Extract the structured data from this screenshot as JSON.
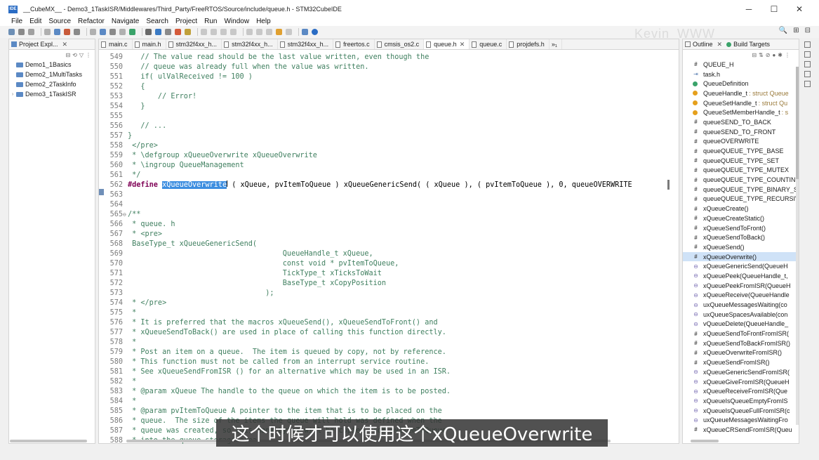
{
  "window": {
    "app_icon_label": "IDE",
    "title": "__CubeMX__ - Demo3_1TaskISR/Middlewares/Third_Party/FreeRTOS/Source/include/queue.h - STM32CubeIDE",
    "controls": [
      "─",
      "☐",
      "✕"
    ]
  },
  "menu": [
    "File",
    "Edit",
    "Source",
    "Refactor",
    "Navigate",
    "Search",
    "Project",
    "Run",
    "Window",
    "Help"
  ],
  "watermark": "Kevin_WWW",
  "toolbar_right": [
    "🔍",
    "⊞",
    "⊟"
  ],
  "project_explorer": {
    "tab_label": "Project Expl...",
    "close": "✕",
    "tools": [
      "⊟",
      "⟲",
      "▽",
      "⋮"
    ],
    "projects": [
      {
        "name": "Demo1_1Basics",
        "arrow": ""
      },
      {
        "name": "Demo2_1MultiTasks",
        "arrow": ""
      },
      {
        "name": "Demo2_2TaskInfo",
        "arrow": ""
      },
      {
        "name": "Demo3_1TaskISR",
        "arrow": "›"
      }
    ]
  },
  "editor": {
    "tabs": [
      {
        "label": "main.c",
        "close": ""
      },
      {
        "label": "main.h",
        "close": ""
      },
      {
        "label": "stm32f4xx_h...",
        "close": ""
      },
      {
        "label": "stm32f4xx_h...",
        "close": ""
      },
      {
        "label": "stm32f4xx_h...",
        "close": ""
      },
      {
        "label": "freertos.c",
        "close": ""
      },
      {
        "label": "cmsis_os2.c",
        "close": ""
      },
      {
        "label": "queue.h",
        "close": "✕"
      },
      {
        "label": "queue.c",
        "close": ""
      },
      {
        "label": "projdefs.h",
        "close": ""
      },
      {
        "label": "»₁",
        "close": ""
      }
    ],
    "lines": [
      {
        "n": "549",
        "fold": "",
        "t": "   // The value read should be the last value written, even though the"
      },
      {
        "n": "550",
        "fold": "",
        "t": "   // queue was already full when the value was written."
      },
      {
        "n": "551",
        "fold": "",
        "t": "   if( ulValReceived != 100 )"
      },
      {
        "n": "552",
        "fold": "",
        "t": "   {"
      },
      {
        "n": "553",
        "fold": "",
        "t": "       // Error!"
      },
      {
        "n": "554",
        "fold": "",
        "t": "   }"
      },
      {
        "n": "555",
        "fold": "",
        "t": ""
      },
      {
        "n": "556",
        "fold": "",
        "t": "   // ..."
      },
      {
        "n": "557",
        "fold": "",
        "t": "}"
      },
      {
        "n": "558",
        "fold": "",
        "t": " </pre>"
      },
      {
        "n": "559",
        "fold": "",
        "t": " * \\defgroup xQueueOverwrite xQueueOverwrite"
      },
      {
        "n": "560",
        "fold": "",
        "t": " * \\ingroup QueueManagement"
      },
      {
        "n": "561",
        "fold": "",
        "t": " */"
      },
      {
        "n": "562",
        "fold": "",
        "t": ""
      },
      {
        "n": "563",
        "fold": "",
        "t": ""
      },
      {
        "n": "564",
        "fold": "",
        "t": ""
      },
      {
        "n": "565",
        "fold": "⊖",
        "t": "/**"
      },
      {
        "n": "566",
        "fold": "",
        "t": " * queue. h"
      },
      {
        "n": "567",
        "fold": "",
        "t": " * <pre>"
      },
      {
        "n": "568",
        "fold": "",
        "t": " BaseType_t xQueueGenericSend("
      },
      {
        "n": "569",
        "fold": "",
        "t": "                                    QueueHandle_t xQueue,"
      },
      {
        "n": "570",
        "fold": "",
        "t": "                                    const void * pvItemToQueue,"
      },
      {
        "n": "571",
        "fold": "",
        "t": "                                    TickType_t xTicksToWait"
      },
      {
        "n": "572",
        "fold": "",
        "t": "                                    BaseType_t xCopyPosition"
      },
      {
        "n": "573",
        "fold": "",
        "t": "                                );"
      },
      {
        "n": "574",
        "fold": "",
        "t": " * </pre>"
      },
      {
        "n": "575",
        "fold": "",
        "t": " *"
      },
      {
        "n": "576",
        "fold": "",
        "t": " * It is preferred that the macros xQueueSend(), xQueueSendToFront() and"
      },
      {
        "n": "577",
        "fold": "",
        "t": " * xQueueSendToBack() are used in place of calling this function directly."
      },
      {
        "n": "578",
        "fold": "",
        "t": " *"
      },
      {
        "n": "579",
        "fold": "",
        "t": " * Post an item on a queue.  The item is queued by copy, not by reference."
      },
      {
        "n": "580",
        "fold": "",
        "t": " * This function must not be called from an interrupt service routine."
      },
      {
        "n": "581",
        "fold": "",
        "t": " * See xQueueSendFromISR () for an alternative which may be used in an ISR."
      },
      {
        "n": "582",
        "fold": "",
        "t": " *"
      },
      {
        "n": "583",
        "fold": "",
        "t": " * @param xQueue The handle to the queue on which the item is to be posted."
      },
      {
        "n": "584",
        "fold": "",
        "t": " *"
      },
      {
        "n": "585",
        "fold": "",
        "t": " * @param pvItemToQueue A pointer to the item that is to be placed on the"
      },
      {
        "n": "586",
        "fold": "",
        "t": " * queue.  The size of the items the queue will hold was defined when the"
      },
      {
        "n": "587",
        "fold": "",
        "t": " * queue was created, so this many bytes will be copied from pvItemToQueue"
      },
      {
        "n": "588",
        "fold": "",
        "t": " * into the queue storage area."
      }
    ],
    "define_line": {
      "keyword": "#define",
      "selected": "xQueueOverwrite",
      "rest": "( xQueue, pvItemToQueue ) xQueueGenericSend( ( xQueue ), ( pvItemToQueue ), 0, queueOVERWRITE"
    }
  },
  "outline": {
    "tabs": [
      {
        "label": "Outline",
        "close": "✕"
      },
      {
        "label": "Build Targets",
        "close": ""
      }
    ],
    "tools": [
      "⊟",
      "⇅",
      "⊘",
      "●",
      "✱",
      "⋮"
    ],
    "items": [
      {
        "icon": "#",
        "icon_kind": "define",
        "label": "QUEUE_H",
        "type": ""
      },
      {
        "icon": "⇥",
        "icon_kind": "include",
        "label": "task.h",
        "type": ""
      },
      {
        "icon": "",
        "icon_kind": "struct",
        "label": "QueueDefinition",
        "type": ""
      },
      {
        "icon": "",
        "icon_kind": "typedef",
        "label": "QueueHandle_t",
        "type": ": struct Queue"
      },
      {
        "icon": "",
        "icon_kind": "typedef",
        "label": "QueueSetHandle_t",
        "type": ": struct Qu"
      },
      {
        "icon": "",
        "icon_kind": "typedef",
        "label": "QueueSetMemberHandle_t",
        "type": ": s"
      },
      {
        "icon": "#",
        "icon_kind": "define",
        "label": "queueSEND_TO_BACK",
        "type": ""
      },
      {
        "icon": "#",
        "icon_kind": "define",
        "label": "queueSEND_TO_FRONT",
        "type": ""
      },
      {
        "icon": "#",
        "icon_kind": "define",
        "label": "queueOVERWRITE",
        "type": ""
      },
      {
        "icon": "#",
        "icon_kind": "define",
        "label": "queueQUEUE_TYPE_BASE",
        "type": ""
      },
      {
        "icon": "#",
        "icon_kind": "define",
        "label": "queueQUEUE_TYPE_SET",
        "type": ""
      },
      {
        "icon": "#",
        "icon_kind": "define",
        "label": "queueQUEUE_TYPE_MUTEX",
        "type": ""
      },
      {
        "icon": "#",
        "icon_kind": "define",
        "label": "queueQUEUE_TYPE_COUNTIN",
        "type": ""
      },
      {
        "icon": "#",
        "icon_kind": "define",
        "label": "queueQUEUE_TYPE_BINARY_S",
        "type": ""
      },
      {
        "icon": "#",
        "icon_kind": "define",
        "label": "queueQUEUE_TYPE_RECURSIV",
        "type": ""
      },
      {
        "icon": "#",
        "icon_kind": "define",
        "label": "xQueueCreate()",
        "type": ""
      },
      {
        "icon": "#",
        "icon_kind": "define",
        "label": "xQueueCreateStatic()",
        "type": ""
      },
      {
        "icon": "#",
        "icon_kind": "define",
        "label": "xQueueSendToFront()",
        "type": ""
      },
      {
        "icon": "#",
        "icon_kind": "define",
        "label": "xQueueSendToBack()",
        "type": ""
      },
      {
        "icon": "#",
        "icon_kind": "define",
        "label": "xQueueSend()",
        "type": ""
      },
      {
        "icon": "#",
        "icon_kind": "define",
        "label": "xQueueOverwrite()",
        "type": ""
      },
      {
        "icon": "⊖",
        "icon_kind": "func",
        "label": "xQueueGenericSend(QueueH",
        "type": ""
      },
      {
        "icon": "⊖",
        "icon_kind": "func",
        "label": "xQueuePeek(QueueHandle_t,",
        "type": ""
      },
      {
        "icon": "⊖",
        "icon_kind": "func",
        "label": "xQueuePeekFromISR(QueueH",
        "type": ""
      },
      {
        "icon": "⊖",
        "icon_kind": "func",
        "label": "xQueueReceive(QueueHandle",
        "type": ""
      },
      {
        "icon": "⊖",
        "icon_kind": "func",
        "label": "uxQueueMessagesWaiting(co",
        "type": ""
      },
      {
        "icon": "⊖",
        "icon_kind": "func",
        "label": "uxQueueSpacesAvailable(con",
        "type": ""
      },
      {
        "icon": "⊖",
        "icon_kind": "func",
        "label": "vQueueDelete(QueueHandle_",
        "type": ""
      },
      {
        "icon": "#",
        "icon_kind": "define",
        "label": "xQueueSendToFrontFromISR(",
        "type": ""
      },
      {
        "icon": "#",
        "icon_kind": "define",
        "label": "xQueueSendToBackFromISR()",
        "type": ""
      },
      {
        "icon": "#",
        "icon_kind": "define",
        "label": "xQueueOverwriteFromISR()",
        "type": ""
      },
      {
        "icon": "#",
        "icon_kind": "define",
        "label": "xQueueSendFromISR()",
        "type": ""
      },
      {
        "icon": "⊖",
        "icon_kind": "func",
        "label": "xQueueGenericSendFromISR(",
        "type": ""
      },
      {
        "icon": "⊖",
        "icon_kind": "func",
        "label": "xQueueGiveFromISR(QueueH",
        "type": ""
      },
      {
        "icon": "⊖",
        "icon_kind": "func",
        "label": "xQueueReceiveFromISR(Que",
        "type": ""
      },
      {
        "icon": "⊖",
        "icon_kind": "func",
        "label": "xQueueIsQueueEmptyFromIS",
        "type": ""
      },
      {
        "icon": "⊖",
        "icon_kind": "func",
        "label": "xQueueIsQueueFullFromISR(c",
        "type": ""
      },
      {
        "icon": "⊖",
        "icon_kind": "func",
        "label": "uxQueueMessagesWaitingFro",
        "type": ""
      },
      {
        "icon": "#",
        "icon_kind": "define",
        "label": "xQueueCRSendFromISR(Queu",
        "type": ""
      }
    ]
  },
  "subtitle": "这个时候才可以使用这个xQueueOverwrite",
  "colors": {
    "selection": "#3d8ee0",
    "comment": "#3f7f5f",
    "keyword": "#7f0055",
    "outline_selected": "#cfe2f7"
  }
}
